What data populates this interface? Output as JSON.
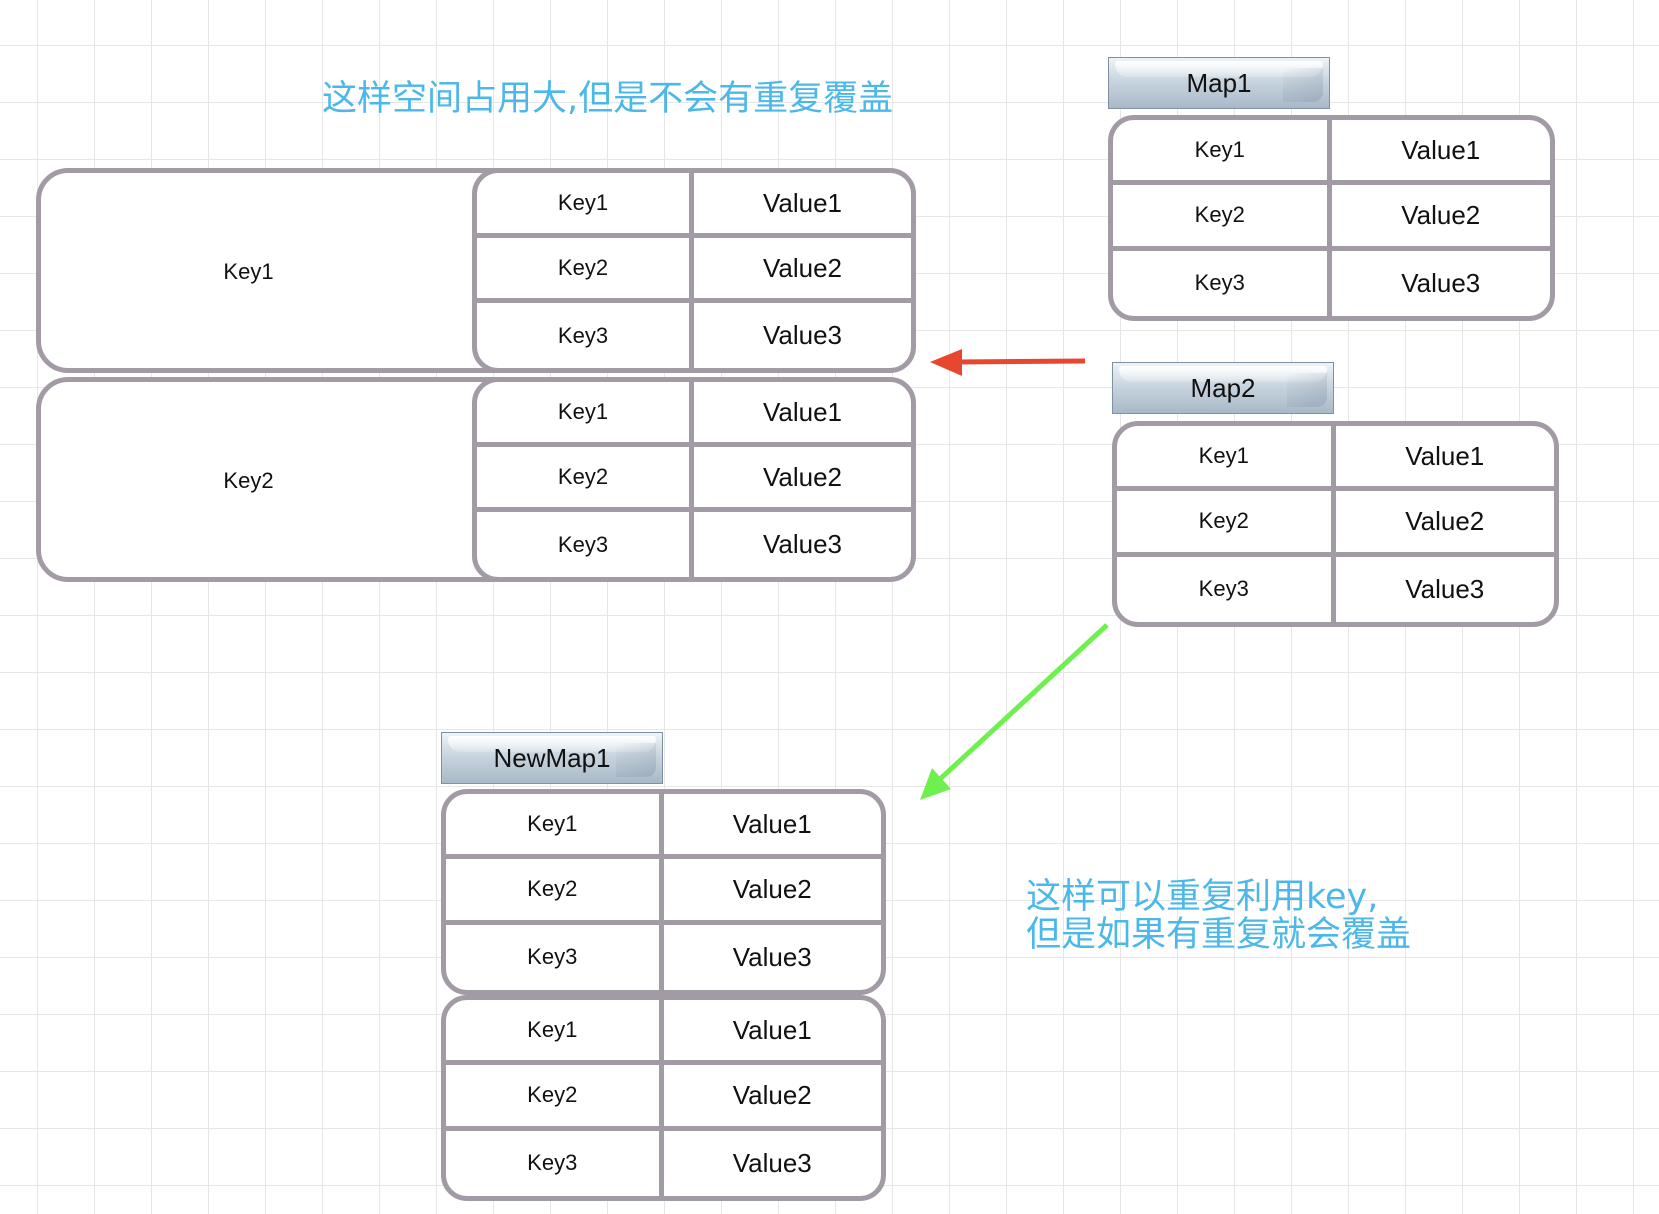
{
  "notes": {
    "top": "这样空间占用大,但是不会有重复覆盖",
    "bottom_line1": "这样可以重复利用key,",
    "bottom_line2": "但是如果有重复就会覆盖"
  },
  "map1": {
    "title": "Map1",
    "rows": [
      {
        "key": "Key1",
        "value": "Value1"
      },
      {
        "key": "Key2",
        "value": "Value2"
      },
      {
        "key": "Key3",
        "value": "Value3"
      }
    ]
  },
  "map2": {
    "title": "Map2",
    "rows": [
      {
        "key": "Key1",
        "value": "Value1"
      },
      {
        "key": "Key2",
        "value": "Value2"
      },
      {
        "key": "Key3",
        "value": "Value3"
      }
    ]
  },
  "nested_map": {
    "entries": [
      {
        "key": "Key1",
        "rows": [
          {
            "key": "Key1",
            "value": "Value1"
          },
          {
            "key": "Key2",
            "value": "Value2"
          },
          {
            "key": "Key3",
            "value": "Value3"
          }
        ]
      },
      {
        "key": "Key2",
        "rows": [
          {
            "key": "Key1",
            "value": "Value1"
          },
          {
            "key": "Key2",
            "value": "Value2"
          },
          {
            "key": "Key3",
            "value": "Value3"
          }
        ]
      }
    ]
  },
  "new_map": {
    "title": "NewMap1",
    "blocks": [
      [
        {
          "key": "Key1",
          "value": "Value1"
        },
        {
          "key": "Key2",
          "value": "Value2"
        },
        {
          "key": "Key3",
          "value": "Value3"
        }
      ],
      [
        {
          "key": "Key1",
          "value": "Value1"
        },
        {
          "key": "Key2",
          "value": "Value2"
        },
        {
          "key": "Key3",
          "value": "Value3"
        }
      ]
    ]
  },
  "colors": {
    "note_text": "#4cb8ea",
    "table_border": "#a29ba5",
    "red_arrow": "#e8472f",
    "green_arrow": "#6ef04e"
  }
}
